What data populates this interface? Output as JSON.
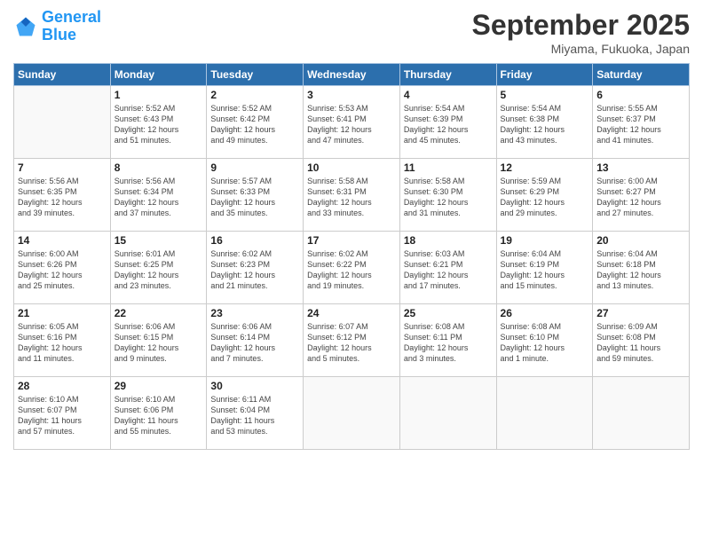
{
  "header": {
    "logo_general": "General",
    "logo_blue": "Blue",
    "month_title": "September 2025",
    "subtitle": "Miyama, Fukuoka, Japan"
  },
  "weekdays": [
    "Sunday",
    "Monday",
    "Tuesday",
    "Wednesday",
    "Thursday",
    "Friday",
    "Saturday"
  ],
  "weeks": [
    [
      {
        "day": "",
        "empty": true
      },
      {
        "day": "1",
        "sunrise": "5:52 AM",
        "sunset": "6:43 PM",
        "daylight": "12 hours and 51 minutes."
      },
      {
        "day": "2",
        "sunrise": "5:52 AM",
        "sunset": "6:42 PM",
        "daylight": "12 hours and 49 minutes."
      },
      {
        "day": "3",
        "sunrise": "5:53 AM",
        "sunset": "6:41 PM",
        "daylight": "12 hours and 47 minutes."
      },
      {
        "day": "4",
        "sunrise": "5:54 AM",
        "sunset": "6:39 PM",
        "daylight": "12 hours and 45 minutes."
      },
      {
        "day": "5",
        "sunrise": "5:54 AM",
        "sunset": "6:38 PM",
        "daylight": "12 hours and 43 minutes."
      },
      {
        "day": "6",
        "sunrise": "5:55 AM",
        "sunset": "6:37 PM",
        "daylight": "12 hours and 41 minutes."
      }
    ],
    [
      {
        "day": "7",
        "sunrise": "5:56 AM",
        "sunset": "6:35 PM",
        "daylight": "12 hours and 39 minutes."
      },
      {
        "day": "8",
        "sunrise": "5:56 AM",
        "sunset": "6:34 PM",
        "daylight": "12 hours and 37 minutes."
      },
      {
        "day": "9",
        "sunrise": "5:57 AM",
        "sunset": "6:33 PM",
        "daylight": "12 hours and 35 minutes."
      },
      {
        "day": "10",
        "sunrise": "5:58 AM",
        "sunset": "6:31 PM",
        "daylight": "12 hours and 33 minutes."
      },
      {
        "day": "11",
        "sunrise": "5:58 AM",
        "sunset": "6:30 PM",
        "daylight": "12 hours and 31 minutes."
      },
      {
        "day": "12",
        "sunrise": "5:59 AM",
        "sunset": "6:29 PM",
        "daylight": "12 hours and 29 minutes."
      },
      {
        "day": "13",
        "sunrise": "6:00 AM",
        "sunset": "6:27 PM",
        "daylight": "12 hours and 27 minutes."
      }
    ],
    [
      {
        "day": "14",
        "sunrise": "6:00 AM",
        "sunset": "6:26 PM",
        "daylight": "12 hours and 25 minutes."
      },
      {
        "day": "15",
        "sunrise": "6:01 AM",
        "sunset": "6:25 PM",
        "daylight": "12 hours and 23 minutes."
      },
      {
        "day": "16",
        "sunrise": "6:02 AM",
        "sunset": "6:23 PM",
        "daylight": "12 hours and 21 minutes."
      },
      {
        "day": "17",
        "sunrise": "6:02 AM",
        "sunset": "6:22 PM",
        "daylight": "12 hours and 19 minutes."
      },
      {
        "day": "18",
        "sunrise": "6:03 AM",
        "sunset": "6:21 PM",
        "daylight": "12 hours and 17 minutes."
      },
      {
        "day": "19",
        "sunrise": "6:04 AM",
        "sunset": "6:19 PM",
        "daylight": "12 hours and 15 minutes."
      },
      {
        "day": "20",
        "sunrise": "6:04 AM",
        "sunset": "6:18 PM",
        "daylight": "12 hours and 13 minutes."
      }
    ],
    [
      {
        "day": "21",
        "sunrise": "6:05 AM",
        "sunset": "6:16 PM",
        "daylight": "12 hours and 11 minutes."
      },
      {
        "day": "22",
        "sunrise": "6:06 AM",
        "sunset": "6:15 PM",
        "daylight": "12 hours and 9 minutes."
      },
      {
        "day": "23",
        "sunrise": "6:06 AM",
        "sunset": "6:14 PM",
        "daylight": "12 hours and 7 minutes."
      },
      {
        "day": "24",
        "sunrise": "6:07 AM",
        "sunset": "6:12 PM",
        "daylight": "12 hours and 5 minutes."
      },
      {
        "day": "25",
        "sunrise": "6:08 AM",
        "sunset": "6:11 PM",
        "daylight": "12 hours and 3 minutes."
      },
      {
        "day": "26",
        "sunrise": "6:08 AM",
        "sunset": "6:10 PM",
        "daylight": "12 hours and 1 minute."
      },
      {
        "day": "27",
        "sunrise": "6:09 AM",
        "sunset": "6:08 PM",
        "daylight": "11 hours and 59 minutes."
      }
    ],
    [
      {
        "day": "28",
        "sunrise": "6:10 AM",
        "sunset": "6:07 PM",
        "daylight": "11 hours and 57 minutes."
      },
      {
        "day": "29",
        "sunrise": "6:10 AM",
        "sunset": "6:06 PM",
        "daylight": "11 hours and 55 minutes."
      },
      {
        "day": "30",
        "sunrise": "6:11 AM",
        "sunset": "6:04 PM",
        "daylight": "11 hours and 53 minutes."
      },
      {
        "day": "",
        "empty": true
      },
      {
        "day": "",
        "empty": true
      },
      {
        "day": "",
        "empty": true
      },
      {
        "day": "",
        "empty": true
      }
    ]
  ]
}
